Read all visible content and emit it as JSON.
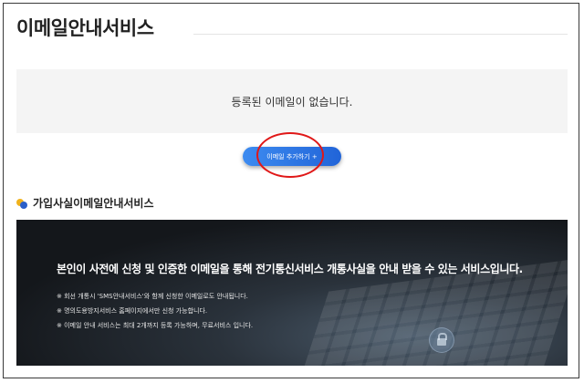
{
  "page": {
    "title": "이메일안내서비스"
  },
  "email_list": {
    "empty_message": "등록된 이메일이 없습니다."
  },
  "actions": {
    "add_email_label": "이메일 추가하기 +"
  },
  "section": {
    "title": "가입사실이메일안내서비스"
  },
  "banner": {
    "headline": "본인이 사전에 신청 및 인증한 이메일을 통해 전기통신서비스 개통사실을 안내 받을 수 있는 서비스입니다.",
    "notes": [
      "※ 회선 개통시 'SMS안내서비스'와 함께 신청한 이메일로도 안내됩니다.",
      "※ 명의도용방지서비스 홈페이지에서만 신청 가능합니다.",
      "※ 이메일 안내 서비스는 최대 2개까지 등록 가능하며, 무료서비스 입니다."
    ]
  },
  "colors": {
    "button_start": "#3d8bf0",
    "button_end": "#2164d8",
    "highlight": "#e01818",
    "icon_yellow": "#f0b21c",
    "icon_blue": "#2a5fc9"
  }
}
